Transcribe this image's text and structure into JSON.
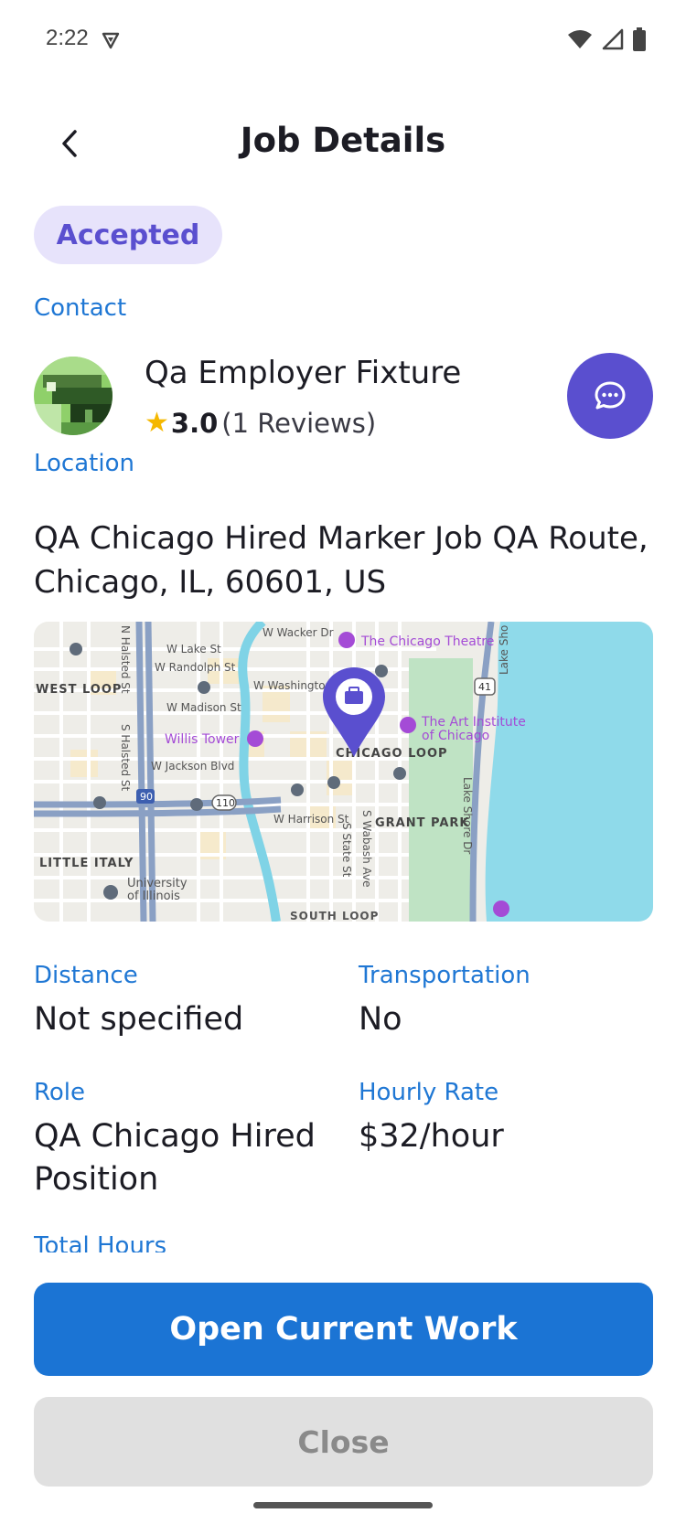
{
  "status_bar": {
    "time": "2:22"
  },
  "header": {
    "title": "Job Details"
  },
  "job_status": "Accepted",
  "contact": {
    "label": "Contact",
    "name": "Qa Employer Fixture",
    "rating": "3.0",
    "reviews": "(1 Reviews)"
  },
  "location": {
    "label": "Location",
    "address": "QA Chicago Hired Marker Job QA Route, Chicago, IL, 60601, US"
  },
  "map": {
    "labels": {
      "wacker": "W Wacker Dr",
      "theatre": "The Chicago Theatre",
      "lake": "W Lake St",
      "randolph": "W Randolph St",
      "westloop": "WEST LOOP",
      "washington": "W Washington St",
      "madison": "W Madison St",
      "willis": "Willis Tower",
      "jackson": "W Jackson Blvd",
      "loop": "CHICAGO LOOP",
      "art1": "The Art Institute",
      "art2": "of Chicago",
      "harrison": "W Harrison St",
      "grantpark": "GRANT PARK",
      "littleitaly": "LITTLE ITALY",
      "uni1": "University",
      "uni2": "of Illinois",
      "halsted1": "N Halsted St",
      "halsted2": "S Halsted St",
      "state": "S State St",
      "wabash": "S Wabash Ave",
      "lakeshore": "Lake Shore Dr",
      "lakeshore2": "Lake Sho",
      "southloop": "SOUTH LOOP",
      "i90": "90",
      "i110": "110",
      "us41": "41"
    }
  },
  "details": {
    "distance_label": "Distance",
    "distance_value": "Not specified",
    "transport_label": "Transportation",
    "transport_value": "No",
    "role_label": "Role",
    "role_value": "QA Chicago Hired Position",
    "rate_label": "Hourly Rate",
    "rate_value": "$32/hour",
    "total_hours_label": "Total Hours"
  },
  "actions": {
    "primary": "Open Current Work",
    "secondary": "Close"
  },
  "colors": {
    "accent": "#1b74d4",
    "brand": "#5a4fcf",
    "badge_bg": "#e7e3fb",
    "label_blue": "#1f77d4"
  }
}
